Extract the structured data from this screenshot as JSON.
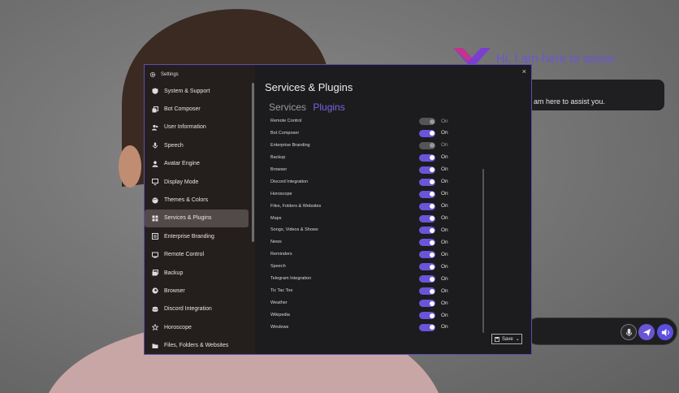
{
  "assistant": {
    "greeting": "Hi, I am here to assist",
    "message": "I am here to assist you."
  },
  "window": {
    "title": "Settings",
    "close_label": "×"
  },
  "sidebar": {
    "items": [
      {
        "label": "System & Support",
        "icon": "gear-shield-icon"
      },
      {
        "label": "Bot Composer",
        "icon": "copy-icon"
      },
      {
        "label": "User Information",
        "icon": "users-icon"
      },
      {
        "label": "Speech",
        "icon": "mic-icon"
      },
      {
        "label": "Avatar Engine",
        "icon": "person-icon"
      },
      {
        "label": "Display Mode",
        "icon": "monitor-icon"
      },
      {
        "label": "Themes & Colors",
        "icon": "palette-icon"
      },
      {
        "label": "Services & Plugins",
        "icon": "grid-icon",
        "active": true
      },
      {
        "label": "Enterprise Branding",
        "icon": "branding-icon"
      },
      {
        "label": "Remote Control",
        "icon": "remote-icon"
      },
      {
        "label": "Backup",
        "icon": "backup-icon"
      },
      {
        "label": "Browser",
        "icon": "globe-icon"
      },
      {
        "label": "Discord Integration",
        "icon": "discord-icon"
      },
      {
        "label": "Horoscope",
        "icon": "star-icon"
      },
      {
        "label": "Files, Folders & Websites",
        "icon": "folder-icon"
      }
    ]
  },
  "content": {
    "title": "Services & Plugins",
    "tabs": [
      {
        "label": "Services",
        "active": false
      },
      {
        "label": "Plugins",
        "active": true
      }
    ],
    "plugins": [
      {
        "name": "Remote Control",
        "state": "On",
        "enabled": false
      },
      {
        "name": "Bot Composer",
        "state": "On",
        "enabled": true
      },
      {
        "name": "Enterprise Branding",
        "state": "On",
        "enabled": false
      },
      {
        "name": "Backup",
        "state": "On",
        "enabled": true
      },
      {
        "name": "Browser",
        "state": "On",
        "enabled": true
      },
      {
        "name": "Discord Integration",
        "state": "On",
        "enabled": true
      },
      {
        "name": "Horoscope",
        "state": "On",
        "enabled": true
      },
      {
        "name": "Files, Folders & Websites",
        "state": "On",
        "enabled": true
      },
      {
        "name": "Maps",
        "state": "On",
        "enabled": true
      },
      {
        "name": "Songs, Videos & Shows",
        "state": "On",
        "enabled": true
      },
      {
        "name": "News",
        "state": "On",
        "enabled": true
      },
      {
        "name": "Reminders",
        "state": "On",
        "enabled": true
      },
      {
        "name": "Speech",
        "state": "On",
        "enabled": true
      },
      {
        "name": "Telegram Integration",
        "state": "On",
        "enabled": true
      },
      {
        "name": "Tic Tac Toe",
        "state": "On",
        "enabled": true
      },
      {
        "name": "Weather",
        "state": "On",
        "enabled": true
      },
      {
        "name": "Wikipedia",
        "state": "On",
        "enabled": true
      },
      {
        "name": "Windows",
        "state": "On",
        "enabled": true
      }
    ],
    "save_label": "Save"
  },
  "colors": {
    "accent": "#6a55d8",
    "window_border": "#5a4fb0",
    "window_bg": "#1c1c1e"
  }
}
